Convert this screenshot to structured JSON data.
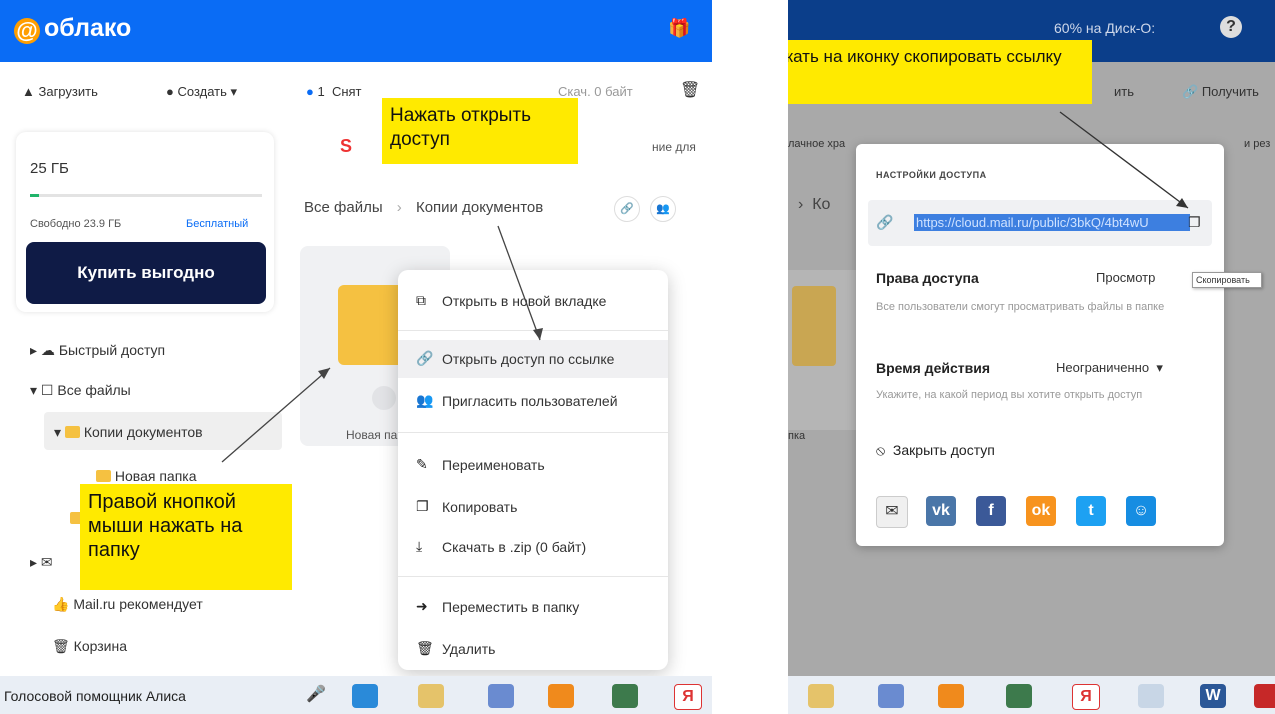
{
  "left": {
    "logo": "облако",
    "toolbar": {
      "upload": "Загрузить",
      "create": "Создать",
      "count": "1",
      "uncheck": "Снят",
      "size": "Скач. 0 байт"
    },
    "storage": {
      "total": "25 ГБ",
      "free": "Свободно 23.9 ГБ",
      "plan": "Бесплатный",
      "used_fraction": 0.04,
      "buy": "Купить выгодно"
    },
    "promo": "ние для",
    "breadcrumb": {
      "root": "Все файлы",
      "current": "Копии документов"
    },
    "tree": [
      {
        "label": "Быстрый доступ"
      },
      {
        "label": "Все файлы"
      },
      {
        "label": "Копии документов"
      },
      {
        "label": "Новая папка"
      },
      {
        "label": "Mail.ru рекомендует"
      },
      {
        "label": "Корзина"
      }
    ],
    "tile_label": "Новая па",
    "menu": [
      {
        "icon": "external-link-icon",
        "label": "Открыть в новой вкладке"
      },
      {
        "icon": "link-icon",
        "label": "Открыть доступ по ссылке"
      },
      {
        "icon": "invite-users-icon",
        "label": "Пригласить пользователей"
      },
      {
        "icon": "rename-icon",
        "label": "Переименовать"
      },
      {
        "icon": "copy-icon",
        "label": "Копировать"
      },
      {
        "icon": "download-icon",
        "label": "Скачать в .zip (0 байт)"
      },
      {
        "icon": "move-icon",
        "label": "Переместить в папку"
      },
      {
        "icon": "trash-icon",
        "label": "Удалить"
      }
    ],
    "callouts": {
      "open_access": "Нажать открыть доступ",
      "right_click": "Правой кнопкой мыши нажать на папку"
    },
    "taskbar": {
      "assistant": "Голосовой помощник Алиса"
    }
  },
  "right": {
    "header": {
      "disk": "60% на Диск-О:",
      "get": "Получить",
      "action": "ить"
    },
    "bg": {
      "left_text": "лачное хра",
      "right_text": "и рез",
      "crumb": "Ко",
      "tile": "пка"
    },
    "callout": "Нажать на иконку скопировать ссылку",
    "panel": {
      "title": "НАСТРОЙКИ ДОСТУПА",
      "url": "https://cloud.mail.ru/public/3bkQ/4bt4wU",
      "tooltip": "Скопировать",
      "rights_label": "Права доступа",
      "rights_value": "Просмотр",
      "rights_hint": "Все пользователи смогут просматривать файлы в папке",
      "time_label": "Время действия",
      "time_value": "Неограниченно",
      "time_hint": "Укажите, на какой период вы хотите открыть доступ",
      "close": "Закрыть доступ",
      "share": [
        {
          "icon": "mail-icon",
          "glyph": "✉",
          "color": "#f0f0f0"
        },
        {
          "icon": "vk-icon",
          "glyph": "vk",
          "color": "#4a76a8"
        },
        {
          "icon": "facebook-icon",
          "glyph": "f",
          "color": "#3b5998"
        },
        {
          "icon": "odnoklassniki-icon",
          "glyph": "ok",
          "color": "#f7931e"
        },
        {
          "icon": "twitter-icon",
          "glyph": "t",
          "color": "#1da1f2"
        },
        {
          "icon": "moimir-icon",
          "glyph": "☺",
          "color": "#168de2"
        }
      ]
    }
  }
}
